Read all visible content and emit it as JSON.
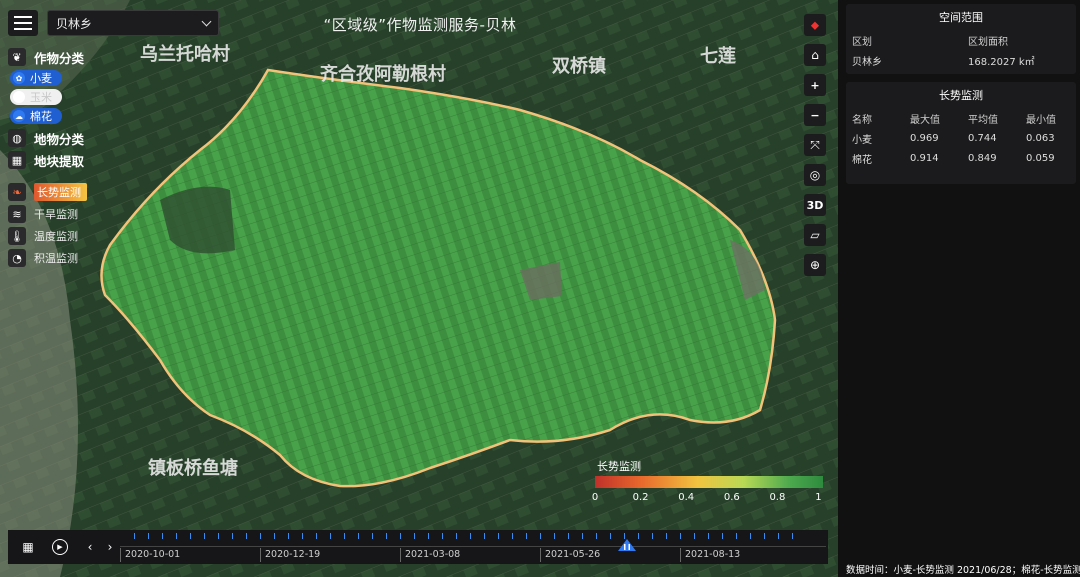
{
  "app": {
    "title": "“区域级”作物监测服务-贝林"
  },
  "region_select": {
    "value": "贝林乡"
  },
  "left_panel": {
    "crop_class": {
      "icon": "leaf-icon",
      "label": "作物分类"
    },
    "crops": [
      {
        "label": "小麦",
        "state": "on"
      },
      {
        "label": "玉米",
        "state": "off"
      },
      {
        "label": "棉花",
        "state": "on"
      }
    ],
    "land_class": {
      "icon": "globe-icon",
      "label": "地物分类"
    },
    "parcel": {
      "icon": "grid-icon",
      "label": "地块提取"
    },
    "monitors": [
      {
        "label": "长势监测",
        "icon": "sprout-icon",
        "active": true
      },
      {
        "label": "干旱监测",
        "icon": "heat-icon",
        "active": false
      },
      {
        "label": "温度监测",
        "icon": "thermometer-icon",
        "active": false
      },
      {
        "label": "积温监测",
        "icon": "gauge-icon",
        "active": false
      }
    ]
  },
  "map_labels": [
    "乌兰托哈村",
    "齐合孜阿勒根村",
    "双桥镇",
    "七莲",
    "镇板桥鱼塘"
  ],
  "toolbar": [
    {
      "icon": "compass-icon",
      "label": ""
    },
    {
      "icon": "home-icon",
      "label": ""
    },
    {
      "icon": "zoom-in-icon",
      "label": "+"
    },
    {
      "icon": "zoom-out-icon",
      "label": "−"
    },
    {
      "icon": "fullscreen-icon",
      "label": ""
    },
    {
      "icon": "eye-off-icon",
      "label": ""
    },
    {
      "icon": "3d-icon",
      "label": "3D"
    },
    {
      "icon": "ruler-icon",
      "label": ""
    },
    {
      "icon": "locate-icon",
      "label": ""
    }
  ],
  "legend": {
    "title": "长势监测",
    "ticks": [
      "0",
      "0.2",
      "0.4",
      "0.6",
      "0.8",
      "1"
    ]
  },
  "timeline": {
    "dates": [
      "2020-10-01",
      "2020-12-19",
      "2021-03-08",
      "2021-05-26",
      "2021-08-13"
    ]
  },
  "spatial_card": {
    "title": "空间范围",
    "headers": [
      "区划",
      "区划面积"
    ],
    "row": [
      "贝林乡",
      "168.2027 k㎡"
    ]
  },
  "growth_card": {
    "title": "长势监测",
    "headers": [
      "名称",
      "最大值",
      "平均值",
      "最小值"
    ],
    "rows": [
      [
        "小麦",
        "0.969",
        "0.744",
        "0.063"
      ],
      [
        "棉花",
        "0.914",
        "0.849",
        "0.059"
      ]
    ]
  },
  "footer": {
    "text": "数据时间：小麦-长势监测 2021/06/28；棉花-长势监测"
  },
  "colors": {
    "accent": "#1f5fd1",
    "boundary": "#f2c27a",
    "field": "#3f9a45"
  }
}
